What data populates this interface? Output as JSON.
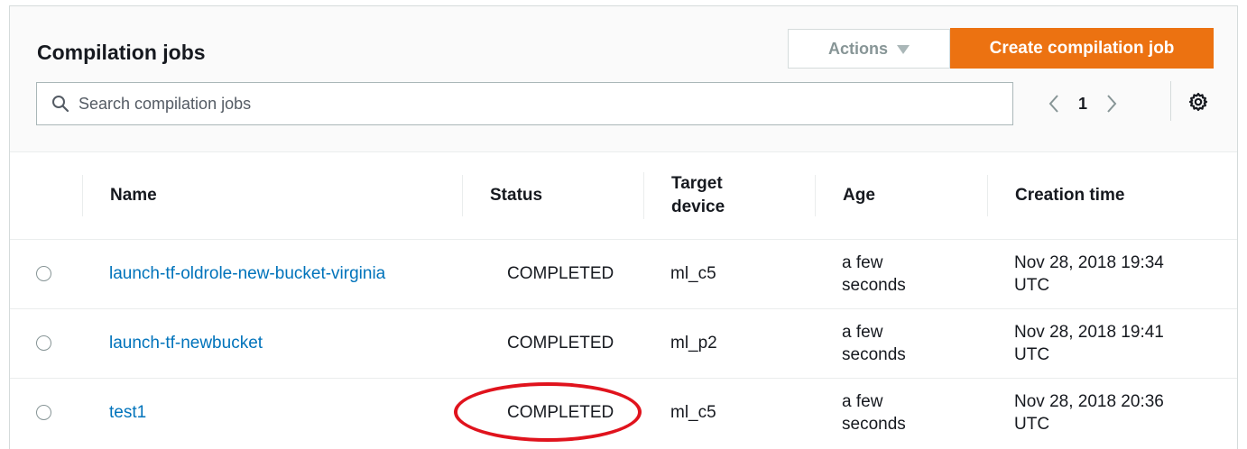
{
  "panel": {
    "title": "Compilation jobs",
    "actions_label": "Actions",
    "create_label": "Create compilation job"
  },
  "search": {
    "placeholder": "Search compilation jobs"
  },
  "pagination": {
    "current_page": "1"
  },
  "table": {
    "columns": [
      "Name",
      "Status",
      "Target device",
      "Age",
      "Creation time"
    ],
    "rows": [
      {
        "name": "launch-tf-oldrole-new-bucket-virginia",
        "status": "COMPLETED",
        "target": "ml_c5",
        "age": "a few seconds",
        "created": "Nov 28, 2018 19:34 UTC"
      },
      {
        "name": "launch-tf-newbucket",
        "status": "COMPLETED",
        "target": "ml_p2",
        "age": "a few seconds",
        "created": "Nov 28, 2018 19:41 UTC"
      },
      {
        "name": "test1",
        "status": "COMPLETED",
        "target": "ml_c5",
        "age": "a few seconds",
        "created": "Nov 28, 2018 20:36 UTC"
      }
    ]
  },
  "icons": {
    "search": "search-icon",
    "actions_caret": "caret-down-icon",
    "prev": "chevron-left-icon",
    "next": "chevron-right-icon",
    "settings": "gear-icon"
  },
  "colors": {
    "primary_button": "#ec7211",
    "link": "#0073bb",
    "annotation": "#e0131d"
  }
}
